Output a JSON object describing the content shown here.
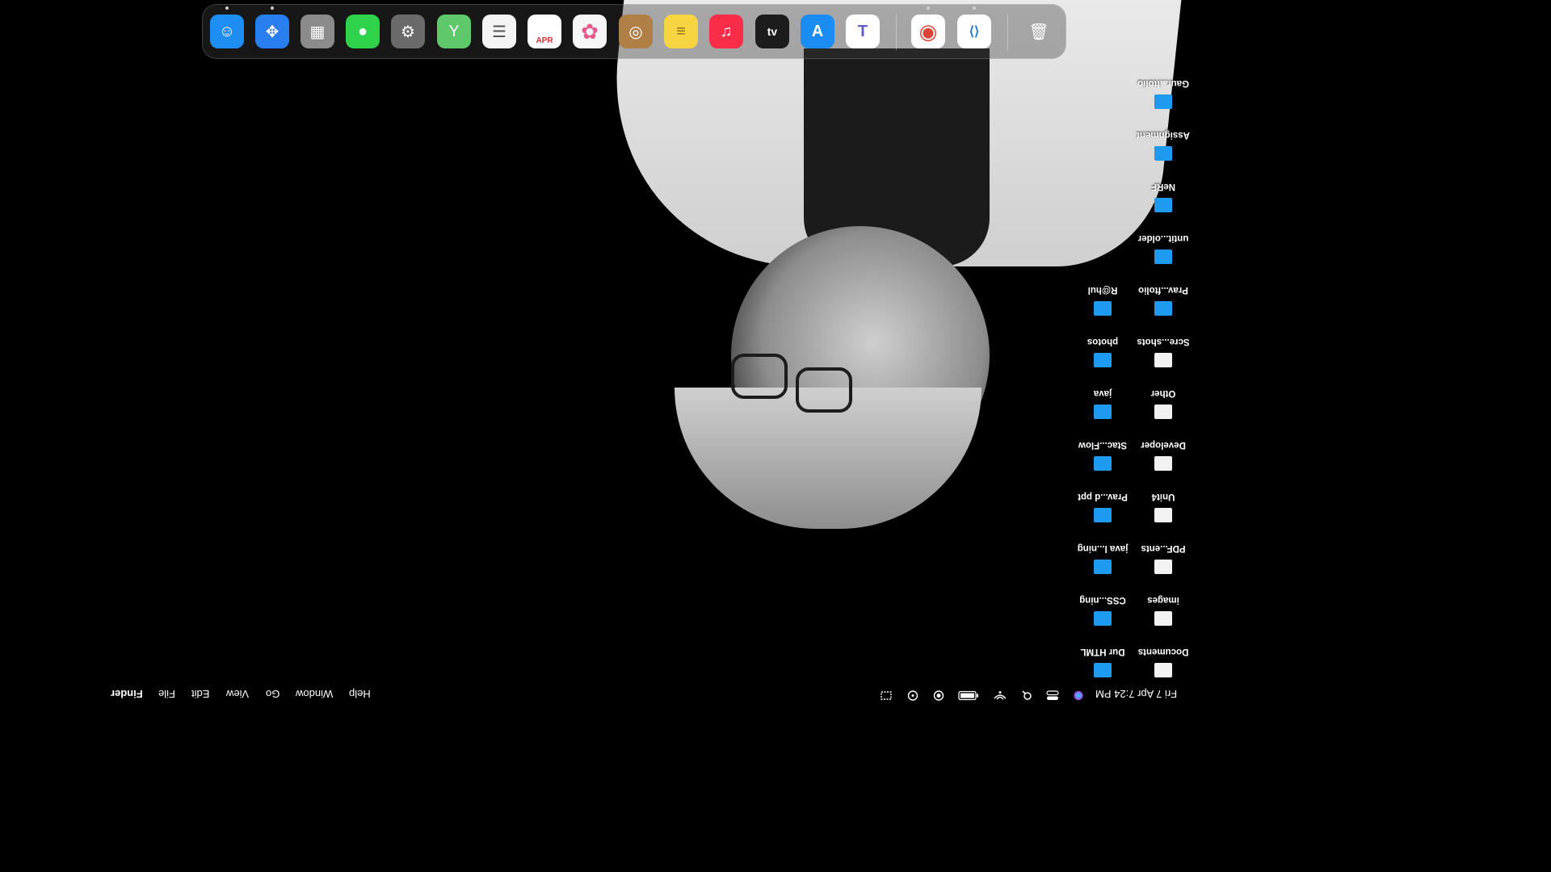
{
  "dock": {
    "apps": [
      {
        "name": "Finder",
        "icon": "finder-icon",
        "glyph": "☺",
        "color": "#1e8ef5",
        "running": true
      },
      {
        "name": "Safari",
        "icon": "safari-icon",
        "glyph": "✥",
        "color": "#2a7ff0",
        "running": true
      },
      {
        "name": "Launchpad",
        "icon": "launchpad-icon",
        "glyph": "▦",
        "color": "#8b8b8b",
        "running": false
      },
      {
        "name": "Messages",
        "icon": "messages-icon",
        "glyph": "●",
        "color": "#2fd24b",
        "running": false
      },
      {
        "name": "System Settings",
        "icon": "settings-icon",
        "glyph": "⚙",
        "color": "#6a6a6a",
        "running": false
      },
      {
        "name": "Maps",
        "icon": "maps-icon",
        "glyph": "Y",
        "color": "#5fc86a",
        "running": false
      },
      {
        "name": "Reminders",
        "icon": "reminders-icon",
        "glyph": "☰",
        "color": "#f4f4f4",
        "running": false
      },
      {
        "name": "Calendar",
        "icon": "calendar-icon",
        "glyph": "APR",
        "color": "#ffffff",
        "running": false
      },
      {
        "name": "Photos",
        "icon": "photos-icon",
        "glyph": "✿",
        "color": "#f6f6f6",
        "running": false
      },
      {
        "name": "Contacts",
        "icon": "contacts-icon",
        "glyph": "◎",
        "color": "#b07f45",
        "running": false
      },
      {
        "name": "Notes",
        "icon": "notes-icon",
        "glyph": "≡",
        "color": "#f7d442",
        "running": false
      },
      {
        "name": "Music",
        "icon": "music-icon",
        "glyph": "♫",
        "color": "#fa2d48",
        "running": false
      },
      {
        "name": "TV",
        "icon": "tv-icon",
        "glyph": "tv",
        "color": "#1c1c1c",
        "running": false
      },
      {
        "name": "App Store",
        "icon": "app-store-icon",
        "glyph": "A",
        "color": "#1a8cf2",
        "running": false
      },
      {
        "name": "Teams",
        "icon": "teams-icon",
        "glyph": "T",
        "color": "#ffffff",
        "running": false
      },
      {
        "name": "Chrome",
        "icon": "chrome-icon",
        "glyph": "◉",
        "color": "#ffffff",
        "running": true
      },
      {
        "name": "VS Code",
        "icon": "vscode-icon",
        "glyph": "⟨⟩",
        "color": "#ffffff",
        "running": true
      },
      {
        "name": "Trash",
        "icon": "trash-icon",
        "glyph": "🗑",
        "color": "#9a9a9a",
        "running": false
      }
    ]
  },
  "menubar": {
    "apple": "",
    "app_name": "Finder",
    "menus": [
      "File",
      "Edit",
      "View",
      "Go",
      "Window",
      "Help"
    ],
    "datetime": "Fri 7 Apr  7:24 PM",
    "status_icons": [
      "screen-mirroring-icon",
      "accessibility-icon",
      "focus-icon",
      "battery-icon",
      "wifi-icon",
      "spotlight-icon",
      "control-center-icon",
      "siri-icon"
    ]
  },
  "desktop": {
    "items": [
      {
        "label": "Gaur...ftolio",
        "kind": "folder"
      },
      {
        "label": "Assignment",
        "kind": "folder"
      },
      {
        "label": "NeRF",
        "kind": "folder"
      },
      {
        "label": "untit...older",
        "kind": "folder"
      },
      {
        "label": "Prav...ftolio",
        "kind": "folder"
      },
      {
        "label": "R@hul",
        "kind": "folder"
      },
      {
        "label": "Scre...shots",
        "kind": "file"
      },
      {
        "label": "photos",
        "kind": "folder"
      },
      {
        "label": "Other",
        "kind": "file"
      },
      {
        "label": "java",
        "kind": "folder"
      },
      {
        "label": "Developer",
        "kind": "file"
      },
      {
        "label": "Stac...Flow",
        "kind": "folder"
      },
      {
        "label": "Unit4",
        "kind": "file"
      },
      {
        "label": "Prav...d ppt",
        "kind": "folder"
      },
      {
        "label": "PDF...ents",
        "kind": "file"
      },
      {
        "label": "java l...ning",
        "kind": "folder"
      },
      {
        "label": "images",
        "kind": "file"
      },
      {
        "label": "CSS...ning",
        "kind": "folder"
      },
      {
        "label": "Documents",
        "kind": "file"
      },
      {
        "label": "Dur HTML",
        "kind": "folder"
      }
    ]
  }
}
